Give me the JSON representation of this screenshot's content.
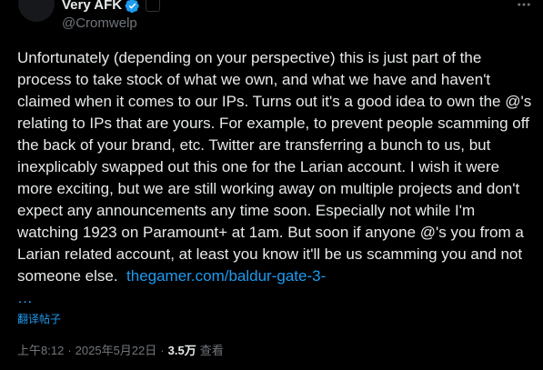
{
  "author": {
    "display_name": "Very AFK",
    "handle": "@Cromwelp"
  },
  "colors": {
    "background": "#000000",
    "text": "#e7e9ea",
    "secondary_text": "#71767b",
    "link": "#1d9bf0",
    "verified_badge": "#1d9bf0"
  },
  "tweet": {
    "text": "Unfortunately (depending on your perspective) this is just part of the process to take stock of what we own, and what we have and haven't claimed when it comes to our IPs. Turns out it's a good idea to own the @'s relating to IPs that are yours. For example, to prevent people scamming off the back of your brand, etc. Twitter are transferring a bunch to us, but inexplicably swapped out this one for the Larian account. I wish it were more exciting, but we are still working away on multiple projects and don't expect any announcements any time soon. Especially not while I'm watching 1923 on Paramount+ at 1am. But soon if anyone @'s you from a Larian related account, at least you know it'll be us scamming you and not someone else.  ",
    "link_text": "thegamer.com/baldur-gate-3-",
    "link_ellipsis": "…",
    "translate_label": "翻译帖子"
  },
  "meta": {
    "time": "上午8:12",
    "separator": "·",
    "date": "2025年5月22日",
    "views_count": "3.5万",
    "views_label": "查看"
  },
  "icons": {
    "verified": "verified-badge-icon",
    "more": "more-options-icon"
  }
}
